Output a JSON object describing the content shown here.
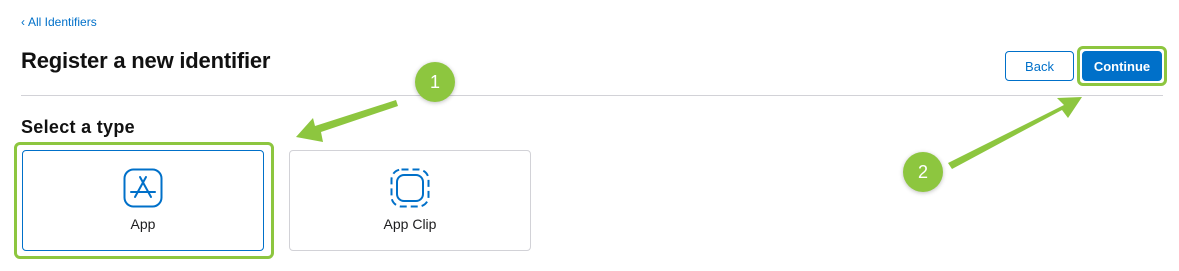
{
  "nav": {
    "back_link_label": "All Identifiers"
  },
  "header": {
    "title": "Register a new identifier",
    "back_button_label": "Back",
    "continue_button_label": "Continue"
  },
  "section": {
    "title": "Select a type"
  },
  "types": [
    {
      "label": "App",
      "icon": "app-store-icon",
      "selected": true
    },
    {
      "label": "App Clip",
      "icon": "app-clip-icon",
      "selected": false
    }
  ],
  "annotations": {
    "step1": "1",
    "step2": "2"
  },
  "colors": {
    "accent": "#0070c9",
    "highlight": "#8dc63f",
    "divider": "#d2d2d7"
  }
}
